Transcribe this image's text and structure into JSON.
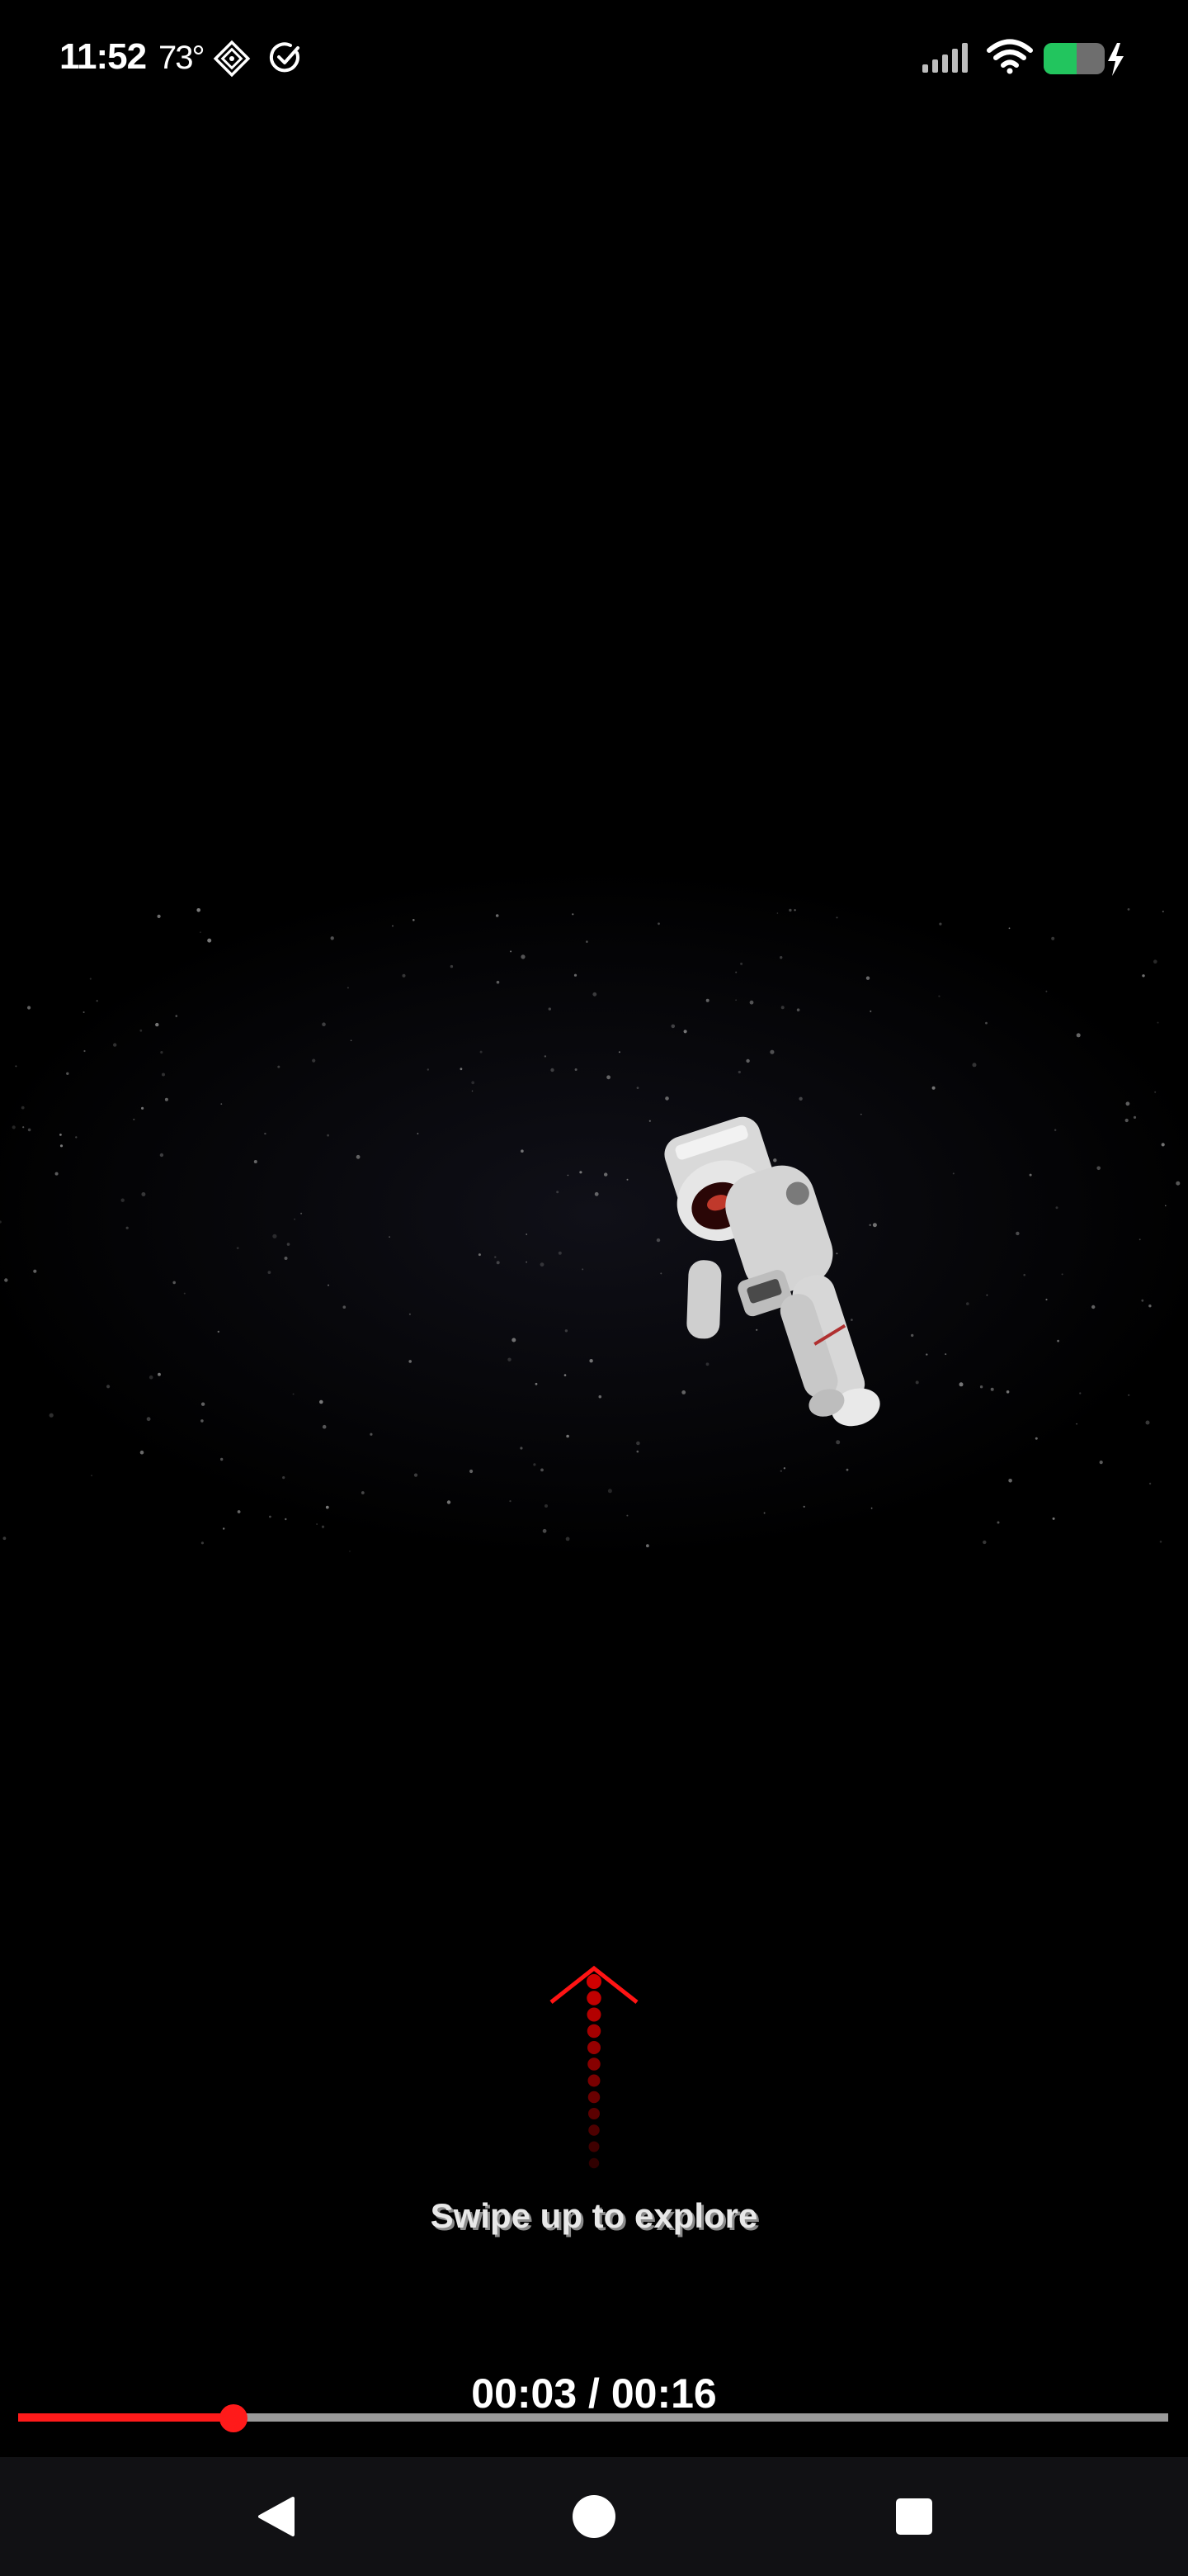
{
  "status_bar": {
    "time": "11:52",
    "temperature": "73°",
    "icons": [
      "diamond-app-icon",
      "check-circle-icon",
      "signal-icon",
      "wifi-icon",
      "battery-charging-icon"
    ]
  },
  "video": {
    "content": "astronaut-floating-in-space",
    "swipe_hint_text": "Swipe up to explore",
    "elapsed": "00:03",
    "separator": " / ",
    "duration": "00:16",
    "time_readout": "00:03 / 00:16",
    "progress_fraction": 0.1875,
    "progress_color": "#ff1a1a",
    "track_color": "#9a9a9a"
  },
  "nav_bar": {
    "icons": [
      "back-icon",
      "home-icon",
      "recents-icon"
    ]
  }
}
